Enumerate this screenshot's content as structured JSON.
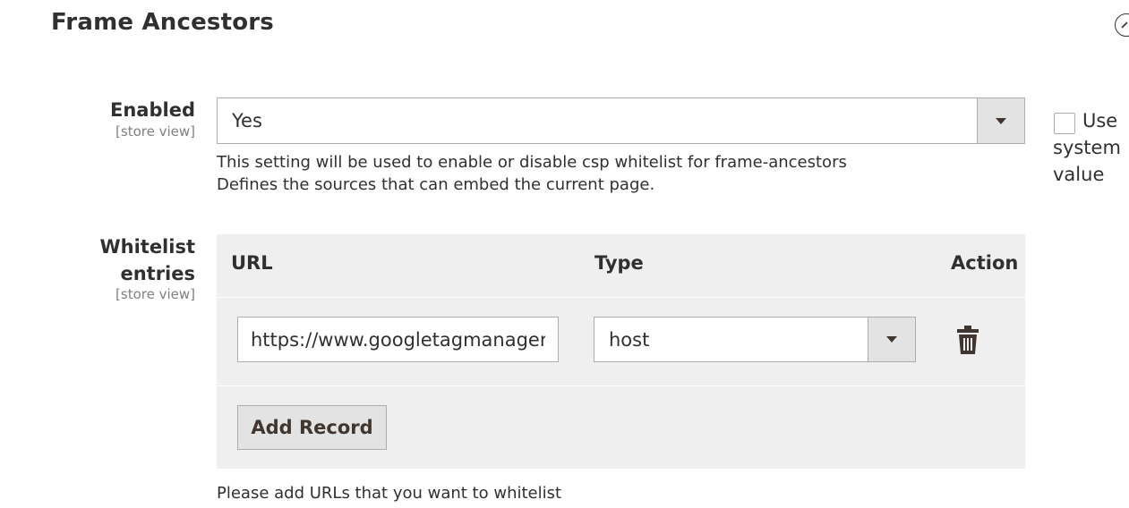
{
  "section": {
    "title": "Frame Ancestors",
    "toggle_icon": "collapse-circle-icon"
  },
  "enabled": {
    "label": "Enabled",
    "scope": "[store view]",
    "value": "Yes",
    "note_line1": "This setting will be used to enable or disable csp whitelist for frame-ancestors",
    "note_line2": "Defines the sources that can embed the current page."
  },
  "use_system": {
    "line1": "Use",
    "line2": "system",
    "line3": "value",
    "checked": false
  },
  "whitelist": {
    "label_line1": "Whitelist",
    "label_line2": "entries",
    "scope": "[store view]",
    "columns": {
      "url": "URL",
      "type": "Type",
      "action": "Action"
    },
    "rows": [
      {
        "url": "https://www.googletagmanager.com",
        "type": "host",
        "delete_icon": "trash-icon"
      }
    ],
    "add_label": "Add Record",
    "note": "Please add URLs that you want to whitelist"
  },
  "colors": {
    "accent_grey": "#e3e3e3",
    "grid_bg": "#efefef",
    "border": "#adadad",
    "text": "#303030"
  }
}
